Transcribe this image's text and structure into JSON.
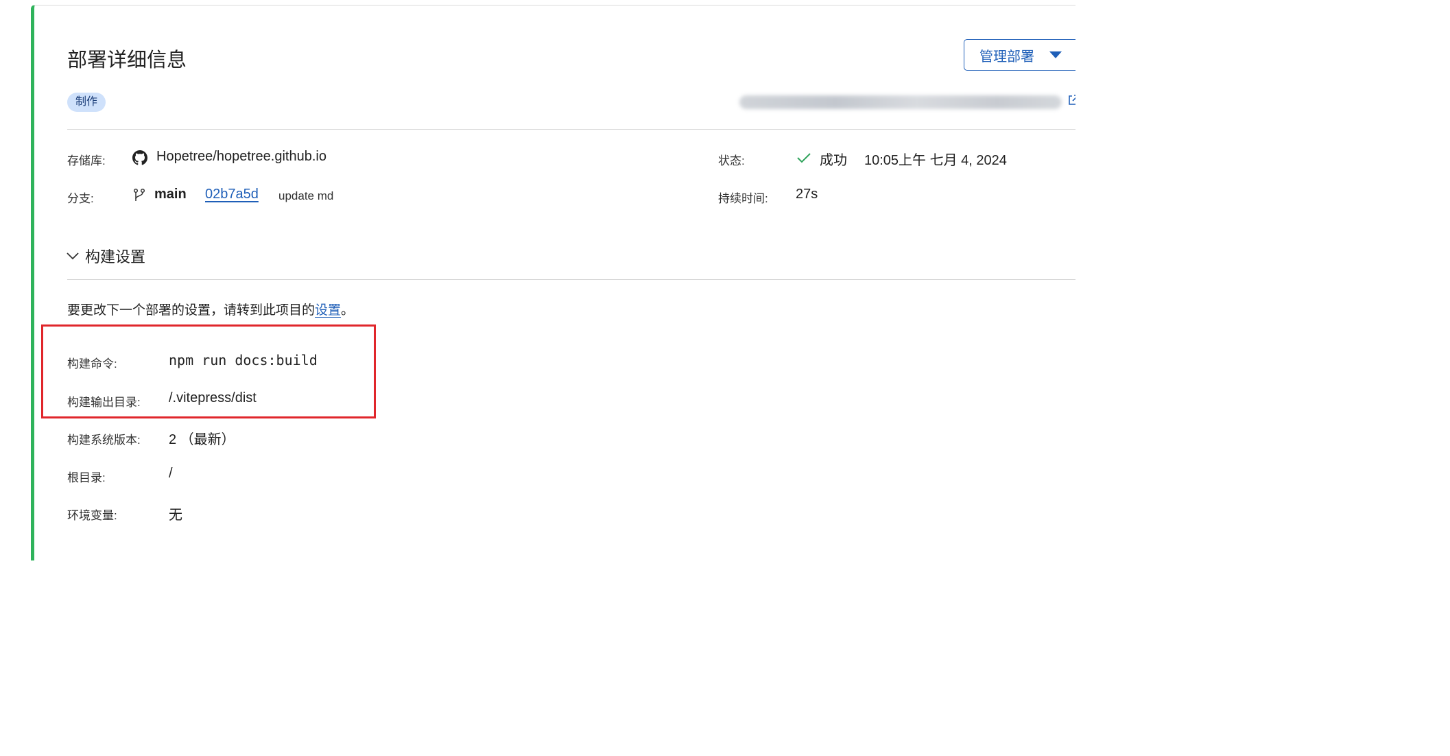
{
  "header": {
    "title": "部署详细信息",
    "manage_button_label": "管理部署",
    "environment_badge": "制作"
  },
  "details": {
    "repository": {
      "label": "存储库:",
      "value": "Hopetree/hopetree.github.io"
    },
    "branch": {
      "label": "分支:",
      "name": "main",
      "commit_hash": "02b7a5d",
      "commit_message": "update md"
    },
    "status": {
      "label": "状态:",
      "value": "成功",
      "timestamp": "10:05上午 七月 4, 2024"
    },
    "duration": {
      "label": "持续时间:",
      "value": "27s"
    }
  },
  "build_settings": {
    "section_title": "构建设置",
    "note_prefix": "要更改下一个部署的设置，请转到此项目的",
    "note_link": "设置",
    "note_suffix": "。",
    "rows": [
      {
        "label": "构建命令:",
        "value": "npm run docs:build"
      },
      {
        "label": "构建输出目录:",
        "value": "/.vitepress/dist"
      },
      {
        "label": "构建系统版本:",
        "value": "2 （最新）"
      },
      {
        "label": "根目录:",
        "value": "/"
      },
      {
        "label": "环境变量:",
        "value": "无"
      }
    ]
  },
  "icons": {
    "repository": "github-icon",
    "branch": "git-branch-icon",
    "status": "checkmark-icon",
    "section_toggle": "chevron-down-icon",
    "external_link": "external-link-icon",
    "manage_caret": "caret-down-icon"
  },
  "colors": {
    "accent": "#1f5fb8",
    "success": "#2fa35b",
    "card_left_border": "#2fb35b",
    "badge_bg": "#cfe1fb",
    "highlight": "#e0262b"
  }
}
